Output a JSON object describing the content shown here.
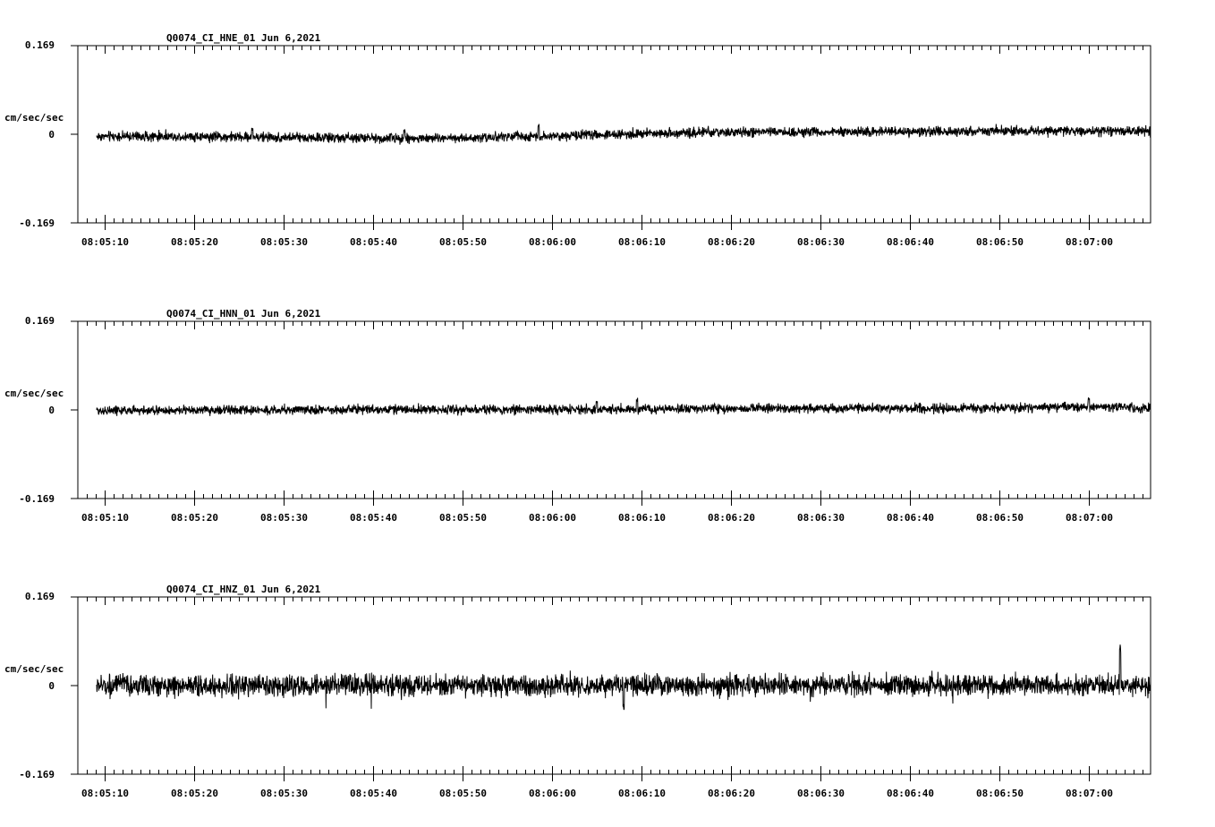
{
  "chart_data": [
    {
      "type": "line",
      "title": "Q0074_CI_HNE_01  Jun 6,2021",
      "ylabel": "cm/sec/sec",
      "ylim": [
        -0.169,
        0.169
      ],
      "y_tick_labels": [
        "0.169",
        "0",
        "-0.169"
      ],
      "x_tick_labels": [
        "08:05:10",
        "08:05:20",
        "08:05:30",
        "08:05:40",
        "08:05:50",
        "08:06:00",
        "08:06:10",
        "08:06:20",
        "08:06:30",
        "08:06:40",
        "08:06:50",
        "08:07:00"
      ],
      "series": [
        {
          "trend": [
            [
              8,
              -0.004
            ],
            [
              20,
              -0.006
            ],
            [
              35,
              -0.008
            ],
            [
              50,
              -0.003
            ],
            [
              65,
              0.003
            ],
            [
              75,
              0.004
            ],
            [
              90,
              0.005
            ],
            [
              100,
              0.007
            ],
            [
              110,
              0.006
            ],
            [
              120,
              0.007
            ]
          ],
          "noise_amplitude": 0.014,
          "spikes": [
            [
              16.5,
              0.02
            ],
            [
              33.5,
              0.019
            ],
            [
              48.5,
              0.025
            ]
          ]
        }
      ]
    },
    {
      "type": "line",
      "title": "Q0074_CI_HNN_01  Jun 6,2021",
      "ylabel": "cm/sec/sec",
      "ylim": [
        -0.169,
        0.169
      ],
      "y_tick_labels": [
        "0.169",
        "0",
        "-0.169"
      ],
      "x_tick_labels": [
        "08:05:10",
        "08:05:20",
        "08:05:30",
        "08:05:40",
        "08:05:50",
        "08:06:00",
        "08:06:10",
        "08:06:20",
        "08:06:30",
        "08:06:40",
        "08:06:50",
        "08:07:00"
      ],
      "series": [
        {
          "trend": [
            [
              8,
              -0.001
            ],
            [
              30,
              0.001
            ],
            [
              55,
              0.001
            ],
            [
              75,
              0.003
            ],
            [
              95,
              0.003
            ],
            [
              112,
              0.006
            ],
            [
              120,
              0.002
            ]
          ],
          "noise_amplitude": 0.013,
          "spikes": [
            [
              55.0,
              0.02
            ],
            [
              59.5,
              0.022
            ],
            [
              110.0,
              0.023
            ]
          ]
        }
      ]
    },
    {
      "type": "line",
      "title": "Q0074_CI_HNZ_01  Jun 6,2021",
      "ylabel": "cm/sec/sec",
      "ylim": [
        -0.169,
        0.169
      ],
      "y_tick_labels": [
        "0.169",
        "0",
        "-0.169"
      ],
      "x_tick_labels": [
        "08:05:10",
        "08:05:20",
        "08:05:30",
        "08:05:40",
        "08:05:50",
        "08:06:00",
        "08:06:10",
        "08:06:20",
        "08:06:30",
        "08:06:40",
        "08:06:50",
        "08:07:00"
      ],
      "series": [
        {
          "trend": [
            [
              8,
              0.0
            ],
            [
              60,
              0.0
            ],
            [
              120,
              0.001
            ]
          ],
          "noise_amplitude": 0.03,
          "spikes": [
            [
              113.5,
              0.08
            ],
            [
              117.5,
              0.045
            ],
            [
              58.0,
              -0.05
            ]
          ]
        }
      ]
    }
  ]
}
